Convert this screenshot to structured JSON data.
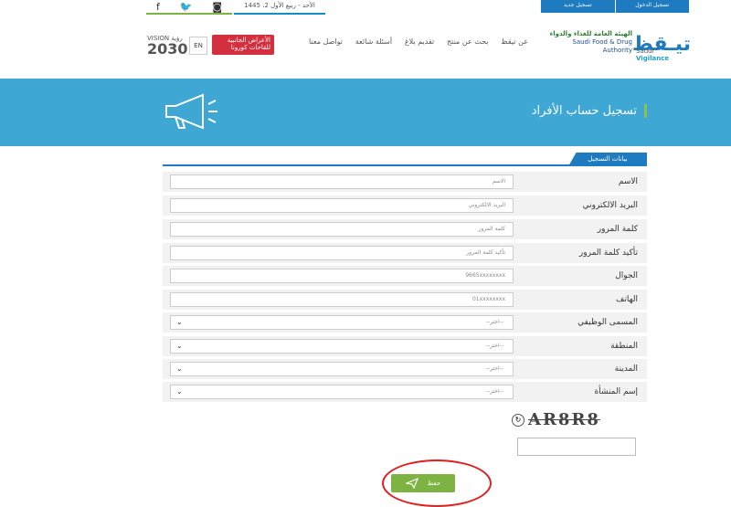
{
  "topbar": {
    "date": "الأحد - ربيع الأول 2، 1445",
    "register": "تسجيل جديد",
    "login": "تسجيل الدخول"
  },
  "header": {
    "vision_line1": "VISION رؤية",
    "vision_year": "2030",
    "lang": "EN",
    "covid_line1": "الأعراض الجانبية",
    "covid_line2": "للقاحات كورونا",
    "nav": [
      "تواصل معنا",
      "أسئلة شائعة",
      "تقديم بلاغ",
      "بحث عن منتج",
      "عن تيقظ"
    ],
    "sfda_ar": "الهيئة العامة للغذاء والدواء",
    "sfda_en": "Saudi Food & Drug Authority",
    "logo_ar": "تيـقظ",
    "logo_en_1": "Saudi",
    "logo_en_2": "Vigilance"
  },
  "banner": {
    "title": "تسجيل حساب الأفراد"
  },
  "section_tab": "بيانات التسجيل",
  "form": {
    "rows": [
      {
        "label": "الاسم",
        "placeholder": "الاسم"
      },
      {
        "label": "البريد الالكتروني",
        "placeholder": "البريد الالكتروني"
      },
      {
        "label": "كلمة المرور",
        "placeholder": "كلمة المرور"
      },
      {
        "label": "تأكيد كلمة المرور",
        "placeholder": "تأكيد كلمة المرور"
      },
      {
        "label": "الجوال",
        "placeholder": "9665xxxxxxxx"
      },
      {
        "label": "الهاتف",
        "placeholder": "01xxxxxxxx"
      },
      {
        "label": "المسمى الوظيفي",
        "value": "--اختر--"
      },
      {
        "label": "المنطقة",
        "value": "--اختر--"
      },
      {
        "label": "المدينة",
        "value": "--اختر--"
      },
      {
        "label": "إسم المنشأة",
        "value": "--اختر--"
      }
    ]
  },
  "captcha": {
    "text": "AR8R8"
  },
  "save_label": "حفظ"
}
